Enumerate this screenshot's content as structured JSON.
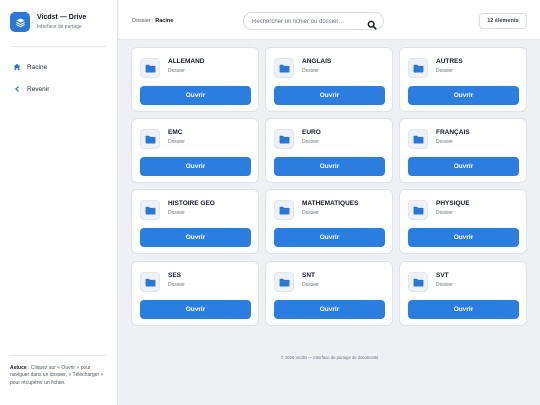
{
  "brand": {
    "title": "Vicdst — Drive",
    "subtitle": "Interface de partage"
  },
  "nav": [
    {
      "label": "Racine",
      "icon": "home-icon"
    },
    {
      "label": "Revenir",
      "icon": "chevron-left-icon"
    }
  ],
  "sidebar_help": {
    "label": "Astuce",
    "text": " : Cliquez sur « Ouvrir » pour naviguer dans un dossier, « Télécharger » pour récupérer un fichier."
  },
  "breadcrumb": {
    "prefix": "Dossier :",
    "current": "Racine"
  },
  "search": {
    "placeholder": "Rechercher un fichier ou dossier…",
    "value": ""
  },
  "item_count": "12 éléments",
  "items": [
    {
      "name": "ALLEMAND",
      "type": "Dossier",
      "action": "Ouvrir"
    },
    {
      "name": "ANGLAIS",
      "type": "Dossier",
      "action": "Ouvrir"
    },
    {
      "name": "AUTRES",
      "type": "Dossier",
      "action": "Ouvrir"
    },
    {
      "name": "EMC",
      "type": "Dossier",
      "action": "Ouvrir"
    },
    {
      "name": "EURO",
      "type": "Dossier",
      "action": "Ouvrir"
    },
    {
      "name": "FRANÇAIS",
      "type": "Dossier",
      "action": "Ouvrir"
    },
    {
      "name": "HISTOIRE GEO",
      "type": "Dossier",
      "action": "Ouvrir"
    },
    {
      "name": "MATHEMATIQUES",
      "type": "Dossier",
      "action": "Ouvrir"
    },
    {
      "name": "PHYSIQUE",
      "type": "Dossier",
      "action": "Ouvrir"
    },
    {
      "name": "SES",
      "type": "Dossier",
      "action": "Ouvrir"
    },
    {
      "name": "SNT",
      "type": "Dossier",
      "action": "Ouvrir"
    },
    {
      "name": "SVT",
      "type": "Dossier",
      "action": "Ouvrir"
    }
  ],
  "footer": "© 2026 Vicdst — Interface de partage de documents",
  "colors": {
    "accent": "#2b7de0",
    "brand": "#2b77d6",
    "background": "#eef0f3"
  }
}
